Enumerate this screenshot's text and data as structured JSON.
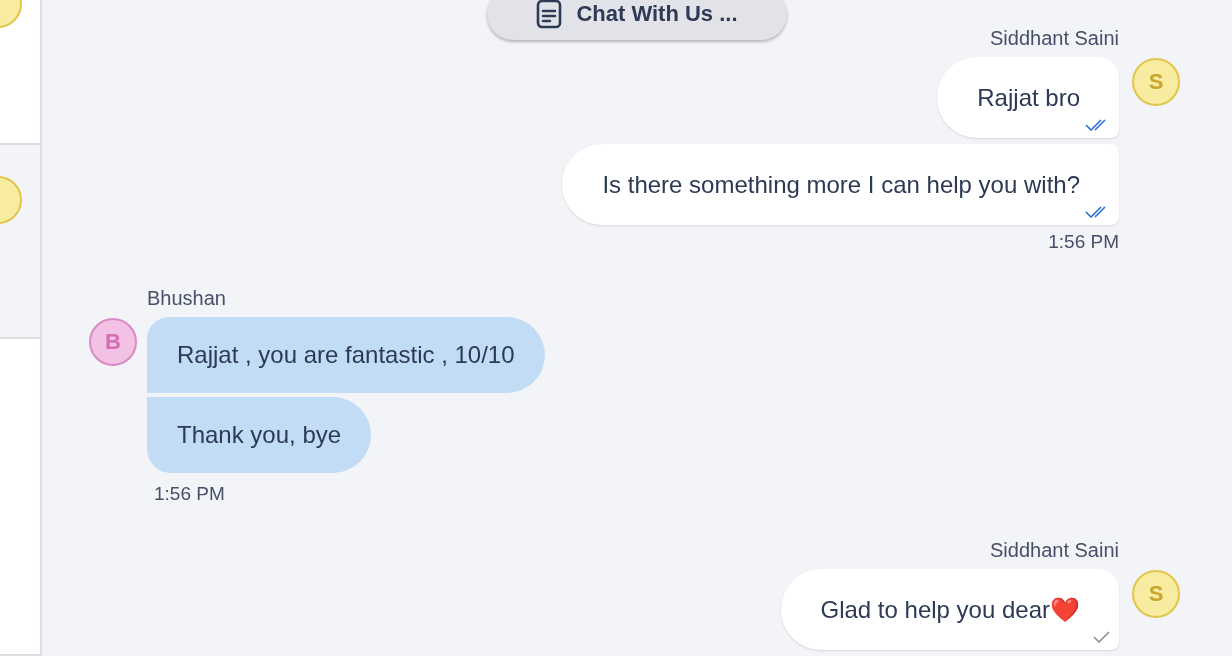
{
  "sidebar": {
    "items": [
      {
        "kind": "avatar",
        "selected": false
      },
      {
        "kind": "avatar",
        "selected": true
      },
      {
        "kind": "empty",
        "selected": false
      }
    ]
  },
  "chat_button": {
    "label": "Chat With Us ..."
  },
  "groups": [
    {
      "kind": "outgoing",
      "sender": "Siddhant Saini",
      "avatar_letter": "S",
      "messages": [
        {
          "text": "Rajjat bro",
          "read": true
        },
        {
          "text": "Is there something more I can help you with?",
          "read": true
        }
      ],
      "time": "1:56 PM"
    },
    {
      "kind": "incoming",
      "sender": "Bhushan",
      "avatar_letter": "B",
      "messages": [
        {
          "text": "Rajjat , you are fantastic , 10/10"
        },
        {
          "text": "Thank you, bye"
        }
      ],
      "time": "1:56 PM"
    },
    {
      "kind": "outgoing",
      "sender": "Siddhant Saini",
      "avatar_letter": "S",
      "messages": [
        {
          "text": "Glad to help you dear❤️",
          "read": false
        }
      ]
    }
  ]
}
